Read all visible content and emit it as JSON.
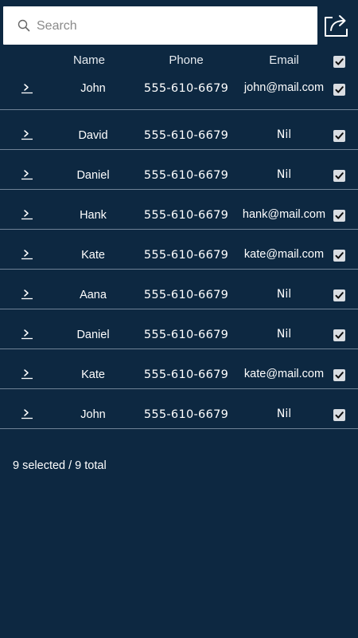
{
  "search": {
    "placeholder": "Search",
    "value": ""
  },
  "toolbar": {
    "share_icon": "share-icon"
  },
  "table": {
    "headers": {
      "name": "Name",
      "phone": "Phone",
      "email": "Email"
    },
    "select_all_checked": true,
    "rows": [
      {
        "name": "John",
        "phone": "555-610-6679",
        "email": "john@mail.com",
        "checked": true
      },
      {
        "name": "David",
        "phone": "555-610-6679",
        "email": "Nil",
        "checked": true
      },
      {
        "name": "Daniel",
        "phone": "555-610-6679",
        "email": "Nil",
        "checked": true
      },
      {
        "name": "Hank",
        "phone": "555-610-6679",
        "email": "hank@mail.com",
        "checked": true
      },
      {
        "name": "Kate",
        "phone": "555-610-6679",
        "email": "kate@mail.com",
        "checked": true
      },
      {
        "name": "Aana",
        "phone": "555-610-6679",
        "email": "Nil",
        "checked": true
      },
      {
        "name": "Daniel",
        "phone": "555-610-6679",
        "email": "Nil",
        "checked": true
      },
      {
        "name": "Kate",
        "phone": "555-610-6679",
        "email": "kate@mail.com",
        "checked": true
      },
      {
        "name": "John",
        "phone": "555-610-6679",
        "email": "Nil",
        "checked": true
      }
    ]
  },
  "footer": {
    "status": "9 selected / 9 total"
  },
  "colors": {
    "background": "#0d2841",
    "divider": "#6f8296",
    "checkbox": "#d9dde2",
    "text": "#ffffff"
  }
}
